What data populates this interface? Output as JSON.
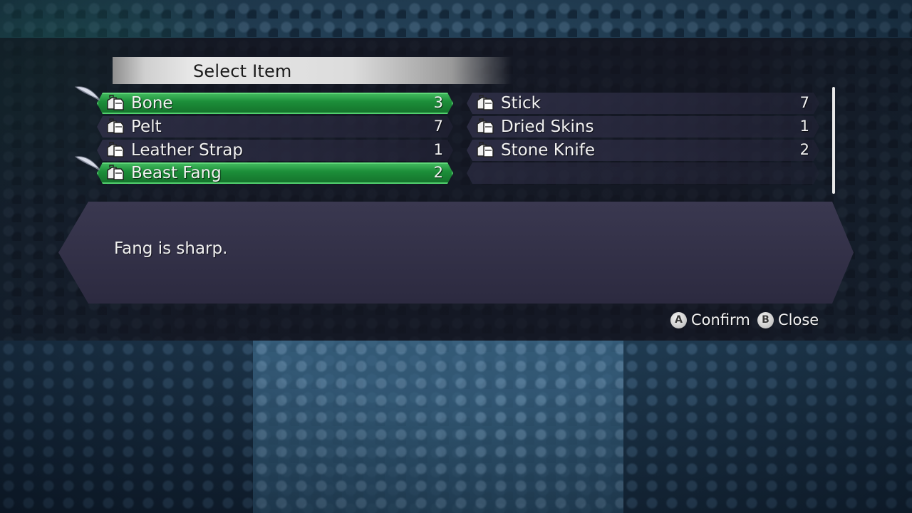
{
  "menu": {
    "title": "Select Item"
  },
  "items_left": [
    {
      "name": "Bone",
      "count": "3",
      "selected": true,
      "marked": true
    },
    {
      "name": "Pelt",
      "count": "7",
      "selected": false,
      "marked": false
    },
    {
      "name": "Leather Strap",
      "count": "1",
      "selected": false,
      "marked": false
    },
    {
      "name": "Beast Fang",
      "count": "2",
      "selected": true,
      "marked": true
    }
  ],
  "items_right": [
    {
      "name": "Stick",
      "count": "7"
    },
    {
      "name": "Dried Skins",
      "count": "1"
    },
    {
      "name": "Stone Knife",
      "count": "2"
    }
  ],
  "description": {
    "text": "Fang is sharp."
  },
  "controls": {
    "confirm_glyph": "A",
    "confirm_label": "Confirm",
    "close_glyph": "B",
    "close_label": "Close"
  },
  "icons": {
    "item_icon": "item-bag-icon",
    "selection_marker": "quill-icon"
  },
  "colors": {
    "selected_row": "#1b8a37",
    "selected_border": "#52d06e",
    "title_bar": "#dcdcdc",
    "panel": "#2c2a40"
  }
}
